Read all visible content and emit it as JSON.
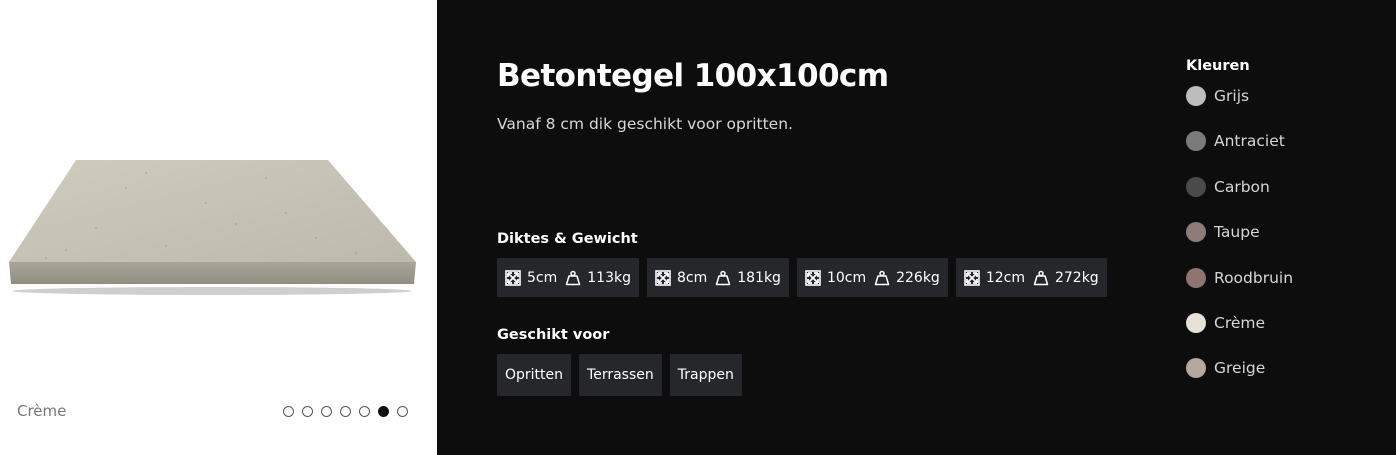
{
  "gallery": {
    "current_color": "Crème",
    "slide_count": 7,
    "active_index": 5
  },
  "product": {
    "title": "Betontegel 100x100cm",
    "subtitle": "Vanaf 8 cm dik geschikt voor opritten."
  },
  "thickness": {
    "heading": "Diktes & Gewicht",
    "options": [
      {
        "thickness": "5cm",
        "weight": "113kg"
      },
      {
        "thickness": "8cm",
        "weight": "181kg"
      },
      {
        "thickness": "10cm",
        "weight": "226kg"
      },
      {
        "thickness": "12cm",
        "weight": "272kg"
      }
    ]
  },
  "suitable": {
    "heading": "Geschikt voor",
    "items": [
      "Opritten",
      "Terrassen",
      "Trappen"
    ]
  },
  "colors": {
    "heading": "Kleuren",
    "items": [
      {
        "name": "Grijs",
        "hex": "#bdbdbf"
      },
      {
        "name": "Antraciet",
        "hex": "#7a7a78"
      },
      {
        "name": "Carbon",
        "hex": "#4a4a4a"
      },
      {
        "name": "Taupe",
        "hex": "#8f7c78"
      },
      {
        "name": "Roodbruin",
        "hex": "#8e7570"
      },
      {
        "name": "Crème",
        "hex": "#e6e2d6"
      },
      {
        "name": "Greige",
        "hex": "#b4a89c"
      }
    ]
  },
  "icons": {
    "thickness": "expand-arrows-icon",
    "weight": "weight-icon"
  }
}
